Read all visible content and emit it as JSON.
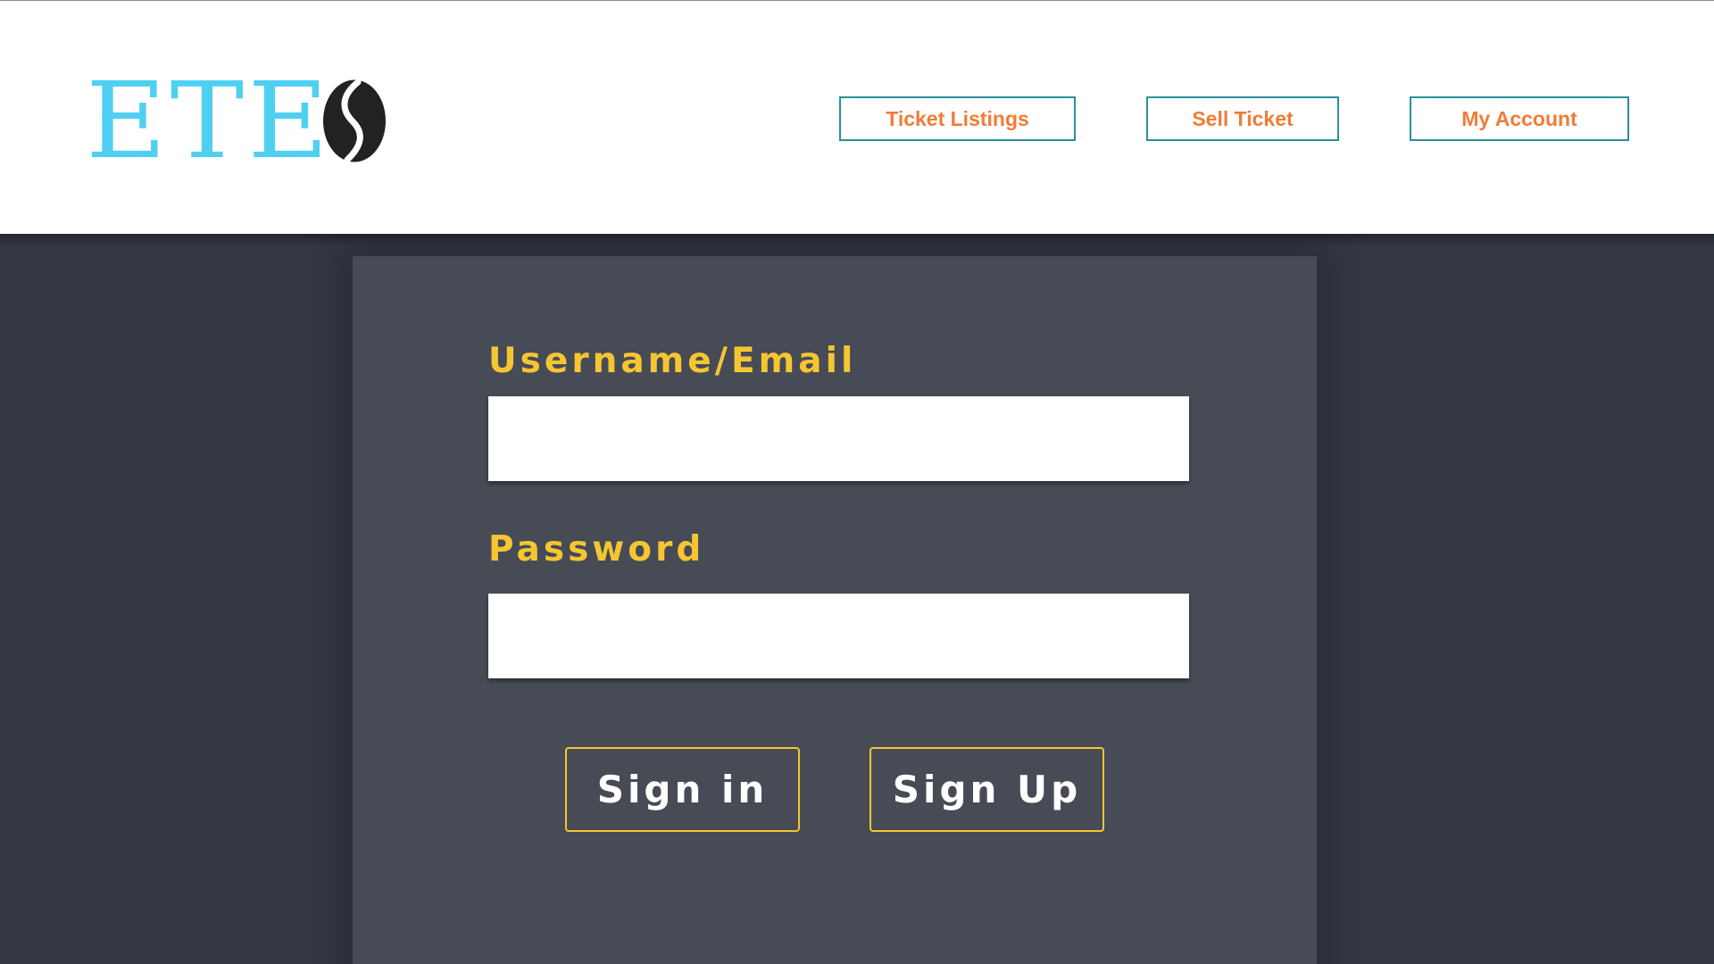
{
  "header": {
    "logo_text": "ETE",
    "logo_color": "#4fd0f0",
    "nav": {
      "listings_label": "Ticket Listings",
      "sell_label": "Sell Ticket",
      "account_label": "My Account"
    },
    "nav_text_color": "#f07c37",
    "nav_border_color": "#2a8f9c"
  },
  "login_form": {
    "username_label": "Username/Email",
    "username_value": "",
    "password_label": "Password",
    "password_value": "",
    "label_color": "#f5c631",
    "sign_in_label": "Sign in",
    "sign_up_label": "Sign Up"
  },
  "theme": {
    "background": "#343844",
    "panel": "#474b56"
  },
  "icons": {
    "logo_mark": "s-curve-logo-icon"
  }
}
